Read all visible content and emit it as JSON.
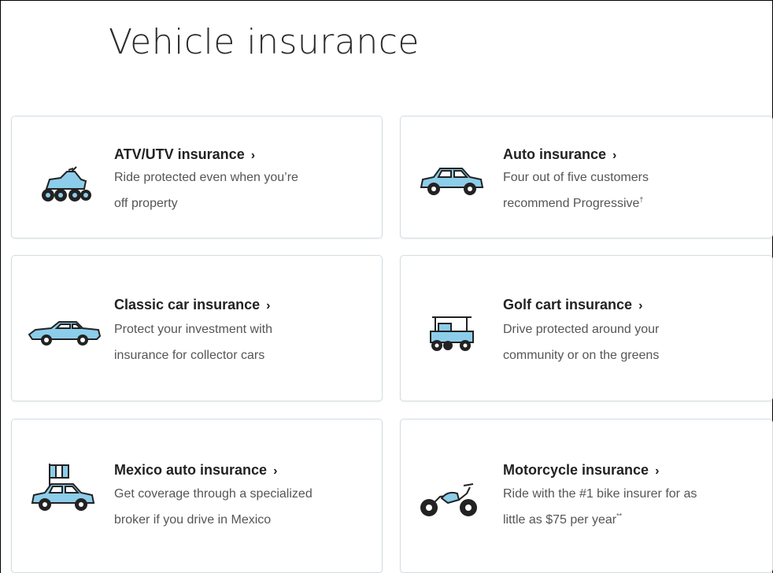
{
  "page": {
    "title": "Vehicle insurance"
  },
  "colors": {
    "icon_fill": "#8ccdea",
    "icon_stroke": "#222222",
    "card_border": "#d3dde3"
  },
  "cards": [
    {
      "title": "ATV/UTV insurance",
      "chevron": "›",
      "desc_lines": [
        "Ride protected even when you’re",
        "off property"
      ],
      "icon": "atv-icon"
    },
    {
      "title": "Auto insurance",
      "chevron": "›",
      "desc_lines": [
        "Four out of five customers",
        "recommend Progressive"
      ],
      "desc_sup": "†",
      "icon": "car-icon"
    },
    {
      "title": "Classic car insurance",
      "chevron": "›",
      "desc_lines": [
        "Protect your investment with",
        "insurance for collector cars"
      ],
      "icon": "classic-car-icon"
    },
    {
      "title": "Golf cart insurance",
      "chevron": "›",
      "desc_lines": [
        "Drive protected around your",
        "community or on the greens"
      ],
      "icon": "golf-cart-icon"
    },
    {
      "title": "Mexico auto insurance",
      "chevron": "›",
      "desc_lines": [
        "Get coverage through a specialized",
        "broker if you drive in Mexico"
      ],
      "icon": "mexico-car-icon"
    },
    {
      "title": "Motorcycle insurance",
      "chevron": "›",
      "desc_lines": [
        "Ride with the #1 bike insurer for as",
        "little as $75 per year"
      ],
      "desc_sup": "**",
      "icon": "motorcycle-icon"
    }
  ]
}
